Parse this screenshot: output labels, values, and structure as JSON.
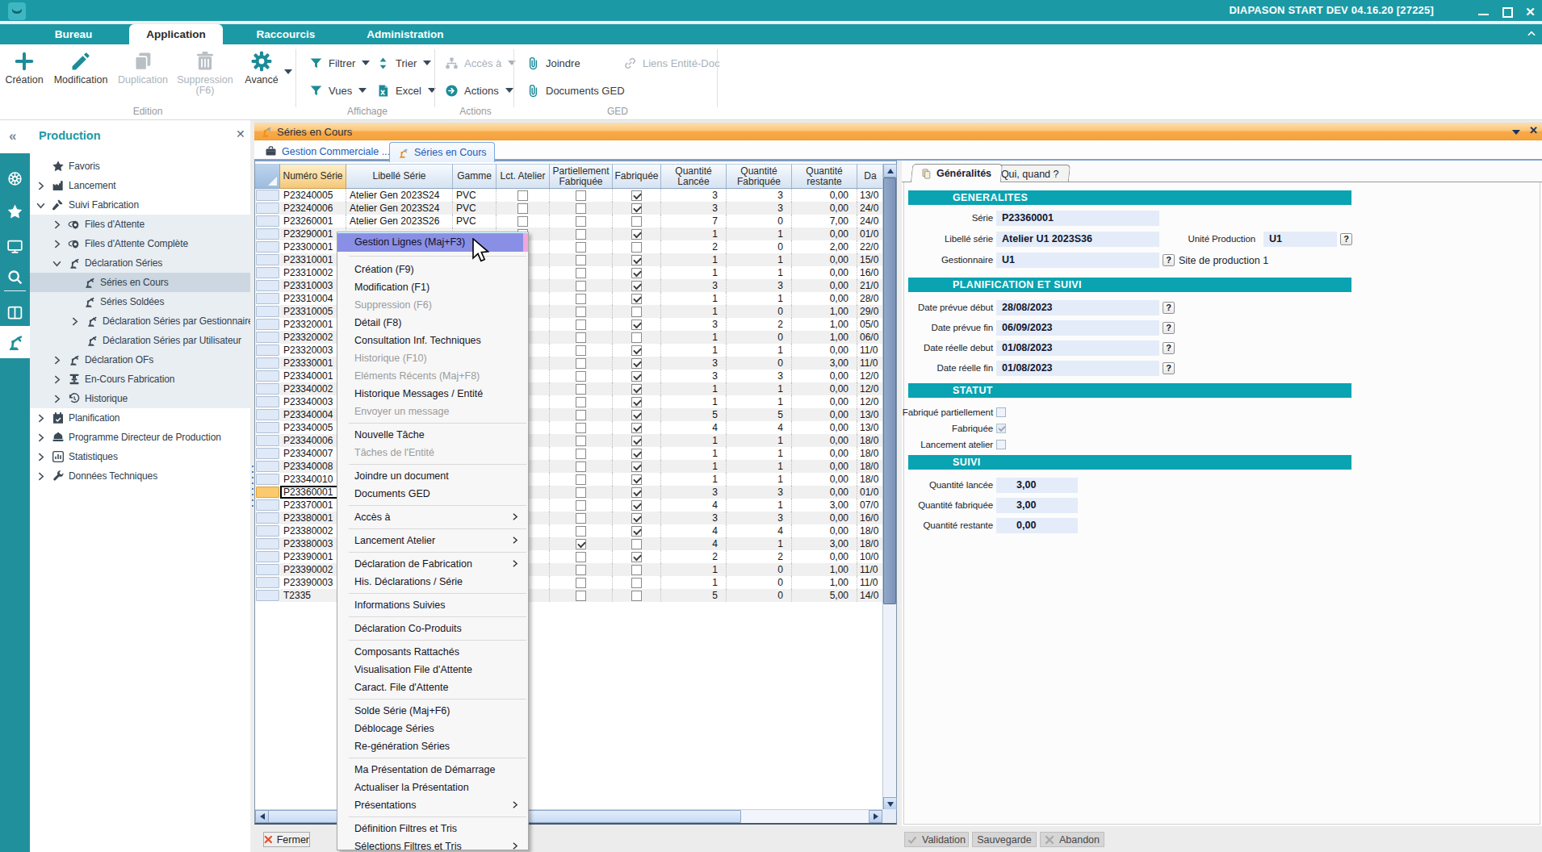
{
  "colors": {
    "teal": "#1b9aa6",
    "orange_bar": "#f6a23c",
    "menu_highlight": "#8a8fe6",
    "selected_row": "#fbc96e"
  },
  "window": {
    "title": "DIAPASON START DEV 04.16.20 [27225]"
  },
  "menubar": {
    "tabs": [
      {
        "label": "Bureau",
        "active": false
      },
      {
        "label": "Application",
        "active": true
      },
      {
        "label": "Raccourcis",
        "active": false
      },
      {
        "label": "Administration",
        "active": false
      }
    ]
  },
  "ribbon": {
    "creation": "Création",
    "modification": "Modification",
    "duplication": "Duplication",
    "suppression_l1": "Suppression",
    "suppression_l2": "(F6)",
    "avance": "Avancé",
    "filtrer": "Filtrer",
    "trier": "Trier",
    "vues": "Vues",
    "excel": "Excel",
    "acces": "Accès à",
    "actions": "Actions",
    "joindre": "Joindre",
    "documents_ged": "Documents GED",
    "liens": "Liens Entité-Doc",
    "group_edition": "Edition",
    "group_affichage": "Affichage",
    "group_actions": "Actions",
    "group_ged": "GED"
  },
  "nav": {
    "title": "Production",
    "items": [
      {
        "label": "Favoris",
        "level": 0,
        "icon": "star",
        "expander": "",
        "block": false,
        "selected": false
      },
      {
        "label": "Lancement",
        "level": 0,
        "icon": "factory",
        "expander": "right",
        "block": false,
        "selected": false
      },
      {
        "label": "Suivi Fabrication",
        "level": 0,
        "icon": "hammer",
        "expander": "down",
        "block": false,
        "selected": false
      },
      {
        "label": "Files d'Attente",
        "level": 1,
        "icon": "gearorbit",
        "expander": "right",
        "block": true,
        "selected": false
      },
      {
        "label": "Files d'Attente Complète",
        "level": 1,
        "icon": "gearorbit",
        "expander": "right",
        "block": true,
        "selected": false
      },
      {
        "label": "Déclaration Séries",
        "level": 1,
        "icon": "robot",
        "expander": "down",
        "block": true,
        "selected": false
      },
      {
        "label": "Séries en Cours",
        "level": 2,
        "icon": "robot",
        "expander": "",
        "block": true,
        "selected": true
      },
      {
        "label": "Séries Soldées",
        "level": 2,
        "icon": "robot",
        "expander": "",
        "block": true,
        "selected": false
      },
      {
        "label": "Déclaration Séries par Gestionnaire",
        "level": 3,
        "icon": "robot",
        "expander": "right",
        "block": true,
        "selected": false
      },
      {
        "label": "Déclaration Séries par Utilisateur",
        "level": 3,
        "icon": "robot",
        "expander": "",
        "block": true,
        "selected": false
      },
      {
        "label": "Déclaration OFs",
        "level": 1,
        "icon": "robot",
        "expander": "right",
        "block": true,
        "selected": false
      },
      {
        "label": "En-Cours Fabrication",
        "level": 1,
        "icon": "press",
        "expander": "right",
        "block": true,
        "selected": false
      },
      {
        "label": "Historique",
        "level": 1,
        "icon": "history",
        "expander": "right",
        "block": true,
        "selected": false
      },
      {
        "label": "Planification",
        "level": 0,
        "icon": "calendar",
        "expander": "right",
        "block": false,
        "selected": false
      },
      {
        "label": "Programme Directeur de Production",
        "level": 0,
        "icon": "hardhat",
        "expander": "right",
        "block": false,
        "selected": false
      },
      {
        "label": "Statistiques",
        "level": 0,
        "icon": "chart",
        "expander": "right",
        "block": false,
        "selected": false
      },
      {
        "label": "Données Techniques",
        "level": 0,
        "icon": "wrench",
        "expander": "right",
        "block": false,
        "selected": false
      }
    ]
  },
  "entity_bar": {
    "title": "Séries en Cours"
  },
  "doc_tabs": [
    {
      "label": "Gestion Commerciale ...",
      "icon": "briefcase",
      "active": false
    },
    {
      "label": "Séries en Cours",
      "icon": "robotorange",
      "active": true
    }
  ],
  "grid": {
    "columns": {
      "num": "Numéro Série",
      "lib": "Libellé Série",
      "gamme": "Gamme",
      "lct": "Lct. Atelier",
      "part1": "Partiellement",
      "part2": "Fabriquée",
      "fab": "Fabriquée",
      "qlan1": "Quantité",
      "qlan2": "Lancée",
      "qfab1": "Quantité",
      "qfab2": "Fabriquée",
      "qrest1": "Quantité",
      "qrest2": "restante",
      "date": "Da"
    },
    "rows": [
      {
        "num": "P23240005",
        "lib": "Atelier Gen 2023S24",
        "gamme": "PVC",
        "lct": false,
        "part": false,
        "fab": true,
        "qlan": "3",
        "qfab": "3",
        "qrest": "0,00",
        "date": "13/0",
        "selected": false
      },
      {
        "num": "P23240006",
        "lib": "Atelier Gen 2023S24",
        "gamme": "PVC",
        "lct": false,
        "part": false,
        "fab": true,
        "qlan": "3",
        "qfab": "3",
        "qrest": "0,00",
        "date": "24/0",
        "selected": false
      },
      {
        "num": "P23260001",
        "lib": "Atelier Gen 2023S26",
        "gamme": "PVC",
        "lct": false,
        "part": false,
        "fab": false,
        "qlan": "7",
        "qfab": "0",
        "qrest": "7,00",
        "date": "24/0",
        "selected": false
      },
      {
        "num": "P23290001",
        "lib": "",
        "gamme": "",
        "lct": false,
        "part": false,
        "fab": true,
        "qlan": "1",
        "qfab": "1",
        "qrest": "0,00",
        "date": "01/0",
        "selected": false
      },
      {
        "num": "P23300001",
        "lib": "",
        "gamme": "",
        "lct": false,
        "part": false,
        "fab": false,
        "qlan": "2",
        "qfab": "0",
        "qrest": "2,00",
        "date": "22/0",
        "selected": false
      },
      {
        "num": "P23310001",
        "lib": "",
        "gamme": "",
        "lct": false,
        "part": false,
        "fab": true,
        "qlan": "1",
        "qfab": "1",
        "qrest": "0,00",
        "date": "15/0",
        "selected": false
      },
      {
        "num": "P23310002",
        "lib": "",
        "gamme": "",
        "lct": false,
        "part": false,
        "fab": true,
        "qlan": "1",
        "qfab": "1",
        "qrest": "0,00",
        "date": "16/0",
        "selected": false
      },
      {
        "num": "P23310003",
        "lib": "",
        "gamme": "",
        "lct": false,
        "part": false,
        "fab": true,
        "qlan": "3",
        "qfab": "3",
        "qrest": "0,00",
        "date": "21/0",
        "selected": false
      },
      {
        "num": "P23310004",
        "lib": "",
        "gamme": "",
        "lct": false,
        "part": false,
        "fab": true,
        "qlan": "1",
        "qfab": "1",
        "qrest": "0,00",
        "date": "28/0",
        "selected": false
      },
      {
        "num": "P23310005",
        "lib": "",
        "gamme": "",
        "lct": false,
        "part": false,
        "fab": false,
        "qlan": "1",
        "qfab": "0",
        "qrest": "1,00",
        "date": "29/0",
        "selected": false
      },
      {
        "num": "P23320001",
        "lib": "",
        "gamme": "",
        "lct": false,
        "part": false,
        "fab": true,
        "qlan": "3",
        "qfab": "2",
        "qrest": "1,00",
        "date": "05/0",
        "selected": false
      },
      {
        "num": "P23320002",
        "lib": "",
        "gamme": "",
        "lct": false,
        "part": false,
        "fab": false,
        "qlan": "1",
        "qfab": "0",
        "qrest": "1,00",
        "date": "06/0",
        "selected": false
      },
      {
        "num": "P23320003",
        "lib": "",
        "gamme": "",
        "lct": false,
        "part": false,
        "fab": true,
        "qlan": "1",
        "qfab": "1",
        "qrest": "0,00",
        "date": "11/0",
        "selected": false
      },
      {
        "num": "P23330001",
        "lib": "",
        "gamme": "",
        "lct": false,
        "part": false,
        "fab": true,
        "qlan": "3",
        "qfab": "0",
        "qrest": "3,00",
        "date": "11/0",
        "selected": false
      },
      {
        "num": "P23340001",
        "lib": "",
        "gamme": "",
        "lct": false,
        "part": false,
        "fab": true,
        "qlan": "3",
        "qfab": "3",
        "qrest": "0,00",
        "date": "12/0",
        "selected": false
      },
      {
        "num": "P23340002",
        "lib": "",
        "gamme": "",
        "lct": false,
        "part": false,
        "fab": true,
        "qlan": "1",
        "qfab": "1",
        "qrest": "0,00",
        "date": "12/0",
        "selected": false
      },
      {
        "num": "P23340003",
        "lib": "",
        "gamme": "",
        "lct": false,
        "part": false,
        "fab": true,
        "qlan": "1",
        "qfab": "1",
        "qrest": "0,00",
        "date": "12/0",
        "selected": false
      },
      {
        "num": "P23340004",
        "lib": "",
        "gamme": "",
        "lct": false,
        "part": false,
        "fab": true,
        "qlan": "5",
        "qfab": "5",
        "qrest": "0,00",
        "date": "13/0",
        "selected": false
      },
      {
        "num": "P23340005",
        "lib": "",
        "gamme": "",
        "lct": false,
        "part": false,
        "fab": true,
        "qlan": "4",
        "qfab": "4",
        "qrest": "0,00",
        "date": "13/0",
        "selected": false
      },
      {
        "num": "P23340006",
        "lib": "",
        "gamme": "",
        "lct": false,
        "part": false,
        "fab": true,
        "qlan": "1",
        "qfab": "1",
        "qrest": "0,00",
        "date": "18/0",
        "selected": false
      },
      {
        "num": "P23340007",
        "lib": "",
        "gamme": "",
        "lct": false,
        "part": false,
        "fab": true,
        "qlan": "1",
        "qfab": "1",
        "qrest": "0,00",
        "date": "18/0",
        "selected": false
      },
      {
        "num": "P23340008",
        "lib": "",
        "gamme": "",
        "lct": false,
        "part": false,
        "fab": true,
        "qlan": "1",
        "qfab": "1",
        "qrest": "0,00",
        "date": "18/0",
        "selected": false
      },
      {
        "num": "P23340010",
        "lib": "",
        "gamme": "",
        "lct": false,
        "part": false,
        "fab": true,
        "qlan": "1",
        "qfab": "1",
        "qrest": "0,00",
        "date": "18/0",
        "selected": false
      },
      {
        "num": "P23360001",
        "lib": "",
        "gamme": "",
        "lct": false,
        "part": false,
        "fab": true,
        "qlan": "3",
        "qfab": "3",
        "qrest": "0,00",
        "date": "01/0",
        "selected": true
      },
      {
        "num": "P23370001",
        "lib": "",
        "gamme": "",
        "lct": false,
        "part": false,
        "fab": true,
        "qlan": "4",
        "qfab": "1",
        "qrest": "3,00",
        "date": "07/0",
        "selected": false
      },
      {
        "num": "P23380001",
        "lib": "",
        "gamme": "",
        "lct": false,
        "part": false,
        "fab": true,
        "qlan": "3",
        "qfab": "3",
        "qrest": "0,00",
        "date": "16/0",
        "selected": false
      },
      {
        "num": "P23380002",
        "lib": "",
        "gamme": "",
        "lct": false,
        "part": false,
        "fab": true,
        "qlan": "4",
        "qfab": "4",
        "qrest": "0,00",
        "date": "18/0",
        "selected": false
      },
      {
        "num": "P23380003",
        "lib": "",
        "gamme": "",
        "lct": false,
        "part": true,
        "fab": false,
        "qlan": "4",
        "qfab": "1",
        "qrest": "3,00",
        "date": "18/0",
        "selected": false
      },
      {
        "num": "P23390001",
        "lib": "",
        "gamme": "",
        "lct": false,
        "part": false,
        "fab": true,
        "qlan": "2",
        "qfab": "2",
        "qrest": "0,00",
        "date": "10/0",
        "selected": false
      },
      {
        "num": "P23390002",
        "lib": "",
        "gamme": "",
        "lct": false,
        "part": false,
        "fab": false,
        "qlan": "1",
        "qfab": "0",
        "qrest": "1,00",
        "date": "11/0",
        "selected": false
      },
      {
        "num": "P23390003",
        "lib": "",
        "gamme": "",
        "lct": false,
        "part": false,
        "fab": false,
        "qlan": "1",
        "qfab": "0",
        "qrest": "1,00",
        "date": "11/0",
        "selected": false
      },
      {
        "num": "T2335",
        "lib": "",
        "gamme": "",
        "lct": false,
        "part": false,
        "fab": false,
        "qlan": "5",
        "qfab": "0",
        "qrest": "5,00",
        "date": "14/0",
        "selected": false
      }
    ]
  },
  "context_menu": {
    "items": [
      {
        "label": "Gestion Lignes (Maj+F3)",
        "highlight": true,
        "disabled": false,
        "submenu": false,
        "sep_before": false,
        "first": true
      },
      {
        "label": "Création (F9)",
        "sep_before": true,
        "firstsep": true,
        "disabled": false,
        "submenu": false
      },
      {
        "label": "Modification (F1)",
        "disabled": false,
        "submenu": false,
        "sep_before": false
      },
      {
        "label": "Suppression (F6)",
        "disabled": true,
        "submenu": false,
        "sep_before": false
      },
      {
        "label": "Détail (F8)",
        "disabled": false,
        "submenu": false,
        "sep_before": false
      },
      {
        "label": "Consultation Inf. Techniques",
        "disabled": false,
        "submenu": false,
        "sep_before": false
      },
      {
        "label": "Historique (F10)",
        "disabled": true,
        "submenu": false,
        "sep_before": false
      },
      {
        "label": "Eléments Récents (Maj+F8)",
        "disabled": true,
        "submenu": false,
        "sep_before": false
      },
      {
        "label": "Historique Messages / Entité",
        "disabled": false,
        "submenu": false,
        "sep_before": false
      },
      {
        "label": "Envoyer un message",
        "disabled": true,
        "submenu": false,
        "sep_before": false
      },
      {
        "label": "Nouvelle Tâche",
        "disabled": false,
        "submenu": false,
        "sep_before": true
      },
      {
        "label": "Tâches de l'Entité",
        "disabled": true,
        "submenu": false,
        "sep_before": false
      },
      {
        "label": "Joindre un document",
        "disabled": false,
        "submenu": false,
        "sep_before": true
      },
      {
        "label": "Documents GED",
        "disabled": false,
        "submenu": false,
        "sep_before": false
      },
      {
        "label": "Accès à",
        "disabled": false,
        "submenu": true,
        "sep_before": true
      },
      {
        "label": "Lancement Atelier",
        "disabled": false,
        "submenu": true,
        "sep_before": true
      },
      {
        "label": "Déclaration de Fabrication",
        "disabled": false,
        "submenu": true,
        "sep_before": true
      },
      {
        "label": "His. Déclarations / Série",
        "disabled": false,
        "submenu": false,
        "sep_before": false
      },
      {
        "label": "Informations Suivies",
        "disabled": false,
        "submenu": false,
        "sep_before": true
      },
      {
        "label": "Déclaration Co-Produits",
        "disabled": false,
        "submenu": false,
        "sep_before": true
      },
      {
        "label": "Composants Rattachés",
        "disabled": false,
        "submenu": false,
        "sep_before": true
      },
      {
        "label": "Visualisation File d'Attente",
        "disabled": false,
        "submenu": false,
        "sep_before": false
      },
      {
        "label": "Caract. File d'Attente",
        "disabled": false,
        "submenu": false,
        "sep_before": false
      },
      {
        "label": "Solde Série (Maj+F6)",
        "disabled": false,
        "submenu": false,
        "sep_before": true
      },
      {
        "label": "Déblocage Séries",
        "disabled": false,
        "submenu": false,
        "sep_before": false
      },
      {
        "label": "Re-génération Séries",
        "disabled": false,
        "submenu": false,
        "sep_before": false
      },
      {
        "label": "Ma Présentation de Démarrage",
        "disabled": false,
        "submenu": false,
        "sep_before": true
      },
      {
        "label": "Actualiser la Présentation",
        "disabled": false,
        "submenu": false,
        "sep_before": false
      },
      {
        "label": "Présentations",
        "disabled": false,
        "submenu": true,
        "sep_before": false
      },
      {
        "label": "Définition Filtres et Tris",
        "disabled": false,
        "submenu": false,
        "sep_before": true
      },
      {
        "label": "Sélections Filtres et Tris",
        "disabled": false,
        "submenu": true,
        "sep_before": false
      }
    ]
  },
  "detail": {
    "tabs": [
      {
        "label": "Généralités",
        "active": true
      },
      {
        "label": "Qui, quand ?",
        "active": false
      }
    ],
    "sections": {
      "generalites": "GENERALITES",
      "planification": "PLANIFICATION ET SUIVI",
      "statut": "STATUT",
      "suivi": "SUIVI"
    },
    "fields": {
      "serie_label": "Série",
      "serie_value": "P23360001",
      "libelle_label": "Libellé série",
      "libelle_value": "Atelier U1 2023S36",
      "unite_label": "Unité Production",
      "unite_value": "U1",
      "gestionnaire_label": "Gestionnaire",
      "gestionnaire_value": "U1",
      "site_text": "Site de production 1",
      "date_prevue_debut_label": "Date prévue début",
      "date_prevue_debut_value": "28/08/2023",
      "date_prevue_fin_label": "Date prévue fin",
      "date_prevue_fin_value": "06/09/2023",
      "date_reelle_debut_label": "Date réelle debut",
      "date_reelle_debut_value": "01/08/2023",
      "date_reelle_fin_label": "Date réelle fin",
      "date_reelle_fin_value": "01/08/2023",
      "fabrique_partiellement_label": "Fabriqué partiellement",
      "fabriquee_label": "Fabriquée",
      "lancement_atelier_label": "Lancement atelier",
      "qte_lancee_label": "Quantité lancée",
      "qte_lancee_value": "3,00",
      "qte_fabriquee_label": "Quantité fabriquée",
      "qte_fabriquee_value": "3,00",
      "qte_restante_label": "Quantité restante",
      "qte_restante_value": "0,00",
      "help": "?"
    }
  },
  "footer": {
    "fermer": "Fermer",
    "validation": "Validation",
    "sauvegarde": "Sauvegarde",
    "abandon": "Abandon"
  }
}
